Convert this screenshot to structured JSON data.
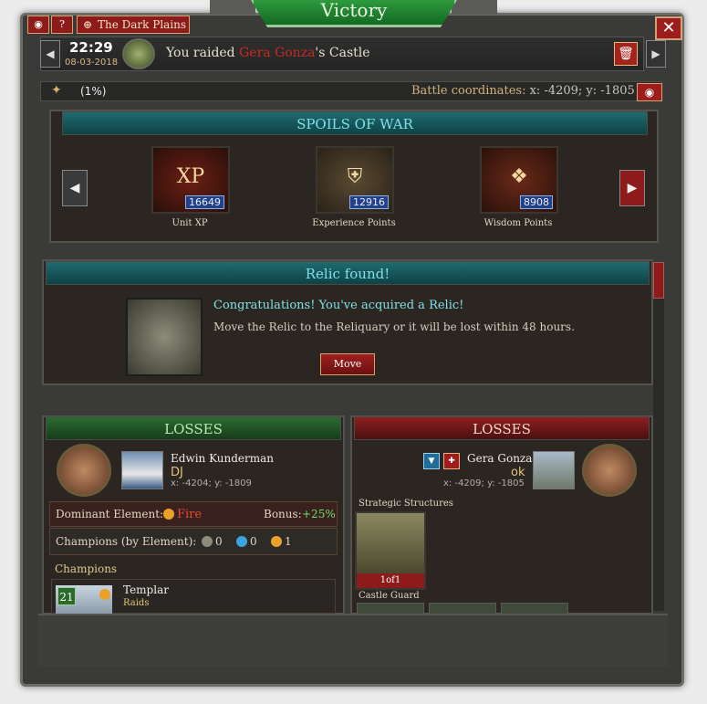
{
  "header": {
    "title": "Victory",
    "location": "The Dark Plains",
    "camera_icon": "camera-icon",
    "help_label": "?",
    "close_label": "✕"
  },
  "report": {
    "time": "22:29",
    "date": "08-03-2018",
    "raid_prefix": "You raided ",
    "enemy_name": "Gera Gonza",
    "raid_suffix": "'s Castle",
    "resource_pct": "(1%)",
    "coords_label": "Battle coordinates: ",
    "coords_value": "x: -4209; y: -1805"
  },
  "spoils": {
    "title": "SPOILS OF WAR",
    "items": [
      {
        "label": "Unit XP",
        "value": "16649",
        "icon": "xp-icon"
      },
      {
        "label": "Experience Points",
        "value": "12916",
        "icon": "shield-icon"
      },
      {
        "label": "Wisdom Points",
        "value": "8908",
        "icon": "owl-icon"
      }
    ]
  },
  "relic": {
    "title": "Relic found!",
    "congrats": "Congratulations! You've acquired a Relic!",
    "note": "Move the Relic to the Reliquary or it will be lost within 48 hours.",
    "move_label": "Move"
  },
  "left": {
    "losses_title": "LOSSES",
    "player_name": "Edwin Kunderman",
    "alliance": "DJ",
    "coords": "x: -4204; y: -1809",
    "dominant_label": "Dominant Element:",
    "dominant_value": "Fire",
    "bonus_label": "Bonus:",
    "bonus_value": "+25%",
    "champions_label": "Champions (by Element):",
    "champ_counts": [
      "0",
      "0",
      "1"
    ],
    "champions_header": "Champions",
    "champion": {
      "level": "21",
      "name": "Templar",
      "type": "Raids"
    }
  },
  "right": {
    "losses_title": "LOSSES",
    "player_name": "Gera Gonza",
    "alliance": "ok",
    "coords": "x: -4209; y: -1805",
    "structures_label": "Strategic Structures",
    "structure_count": "1of1",
    "guard_label": "Castle Guard"
  },
  "colors": {
    "accent_red": "#8e1b1b",
    "teal_text": "#7fe0e6",
    "enemy_red": "#c82a22",
    "bonus_green": "#6be06b",
    "fire_red": "#e34a35"
  }
}
